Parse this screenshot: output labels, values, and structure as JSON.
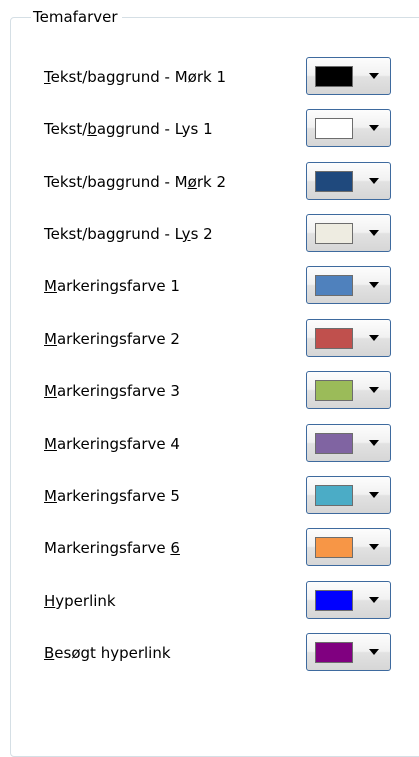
{
  "group": {
    "title": "Temafarver"
  },
  "rows": [
    {
      "label": "Tekst/baggrund - Mørk 1",
      "accel": 0,
      "color": "#000000"
    },
    {
      "label": "Tekst/baggrund - Lys 1",
      "accel": 6,
      "color": "#ffffff"
    },
    {
      "label": "Tekst/baggrund - Mørk 2",
      "accel": 18,
      "color": "#1f497d"
    },
    {
      "label": "Tekst/baggrund - Lys 2",
      "accel": 18,
      "color": "#eeece1"
    },
    {
      "label": "Markeringsfarve 1",
      "accel": 0,
      "color": "#4f81bd"
    },
    {
      "label": "Markeringsfarve 2",
      "accel": 0,
      "color": "#c0504d"
    },
    {
      "label": "Markeringsfarve 3",
      "accel": 0,
      "color": "#9bbb59"
    },
    {
      "label": "Markeringsfarve 4",
      "accel": 0,
      "color": "#8064a2"
    },
    {
      "label": "Markeringsfarve 5",
      "accel": 0,
      "color": "#4bacc6"
    },
    {
      "label": "Markeringsfarve 6",
      "accel": 16,
      "color": "#f79646"
    },
    {
      "label": "Hyperlink",
      "accel": 0,
      "color": "#0000ff"
    },
    {
      "label": "Besøgt hyperlink",
      "accel": 0,
      "color": "#800080"
    }
  ]
}
